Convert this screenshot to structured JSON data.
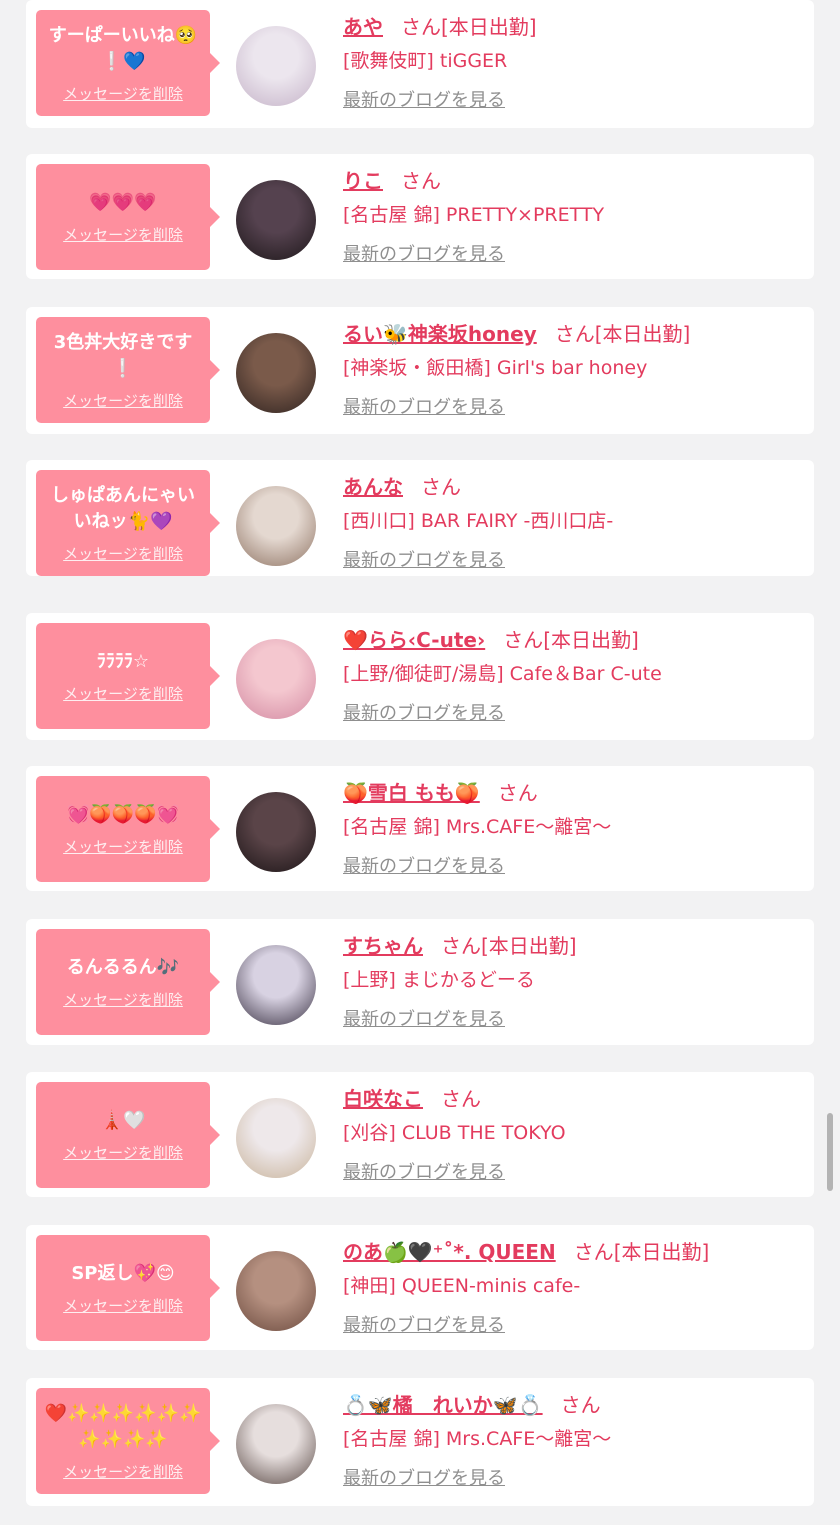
{
  "delete_label": "メッセージを削除",
  "blog_label": "最新のブログを見る",
  "honorific": "さん",
  "cards": [
    {
      "message": "すーぱーいいね🥺❕💙",
      "name": "あや",
      "attendance": "[本日出勤]",
      "shop": "[歌舞伎町] tiGGER",
      "avatar_colors": [
        "#ece6ee",
        "#c5b3c8"
      ]
    },
    {
      "message": "💗💗💗",
      "name": "りこ",
      "attendance": "",
      "shop": "[名古屋 錦] PRETTY×PRETTY",
      "avatar_colors": [
        "#55424f",
        "#1d1719"
      ]
    },
    {
      "message": "3色丼大好きです❕",
      "name": "るい🐝神楽坂honey",
      "attendance": "[本日出勤]",
      "shop": "[神楽坂・飯田橋] Girl's bar honey",
      "avatar_colors": [
        "#7a5a4a",
        "#2f2320"
      ]
    },
    {
      "message": "しゅぱあんにゃいいねッ🐈💜",
      "name": "あんな",
      "attendance": "",
      "shop": "[西川口] BAR FAIRY -西川口店-",
      "avatar_colors": [
        "#e4d8d0",
        "#8f7464"
      ]
    },
    {
      "message": "ﾗﾗﾗﾗ☆",
      "name": "❤️らら‹C-ute›",
      "attendance": "[本日出勤]",
      "shop": "[上野/御徒町/湯島] Cafe＆Bar C-ute",
      "avatar_colors": [
        "#f4c7cf",
        "#d38aa2"
      ]
    },
    {
      "message": "💓🍑🍑🍑💓",
      "name": "🍑雪白 もも🍑",
      "attendance": "",
      "shop": "[名古屋 錦] Mrs.CAFE〜離宮〜",
      "avatar_colors": [
        "#5a4448",
        "#1b1416"
      ]
    },
    {
      "message": "るんるるん🎶",
      "name": "すちゃん",
      "attendance": "[本日出勤]",
      "shop": "[上野] まじかるどーる",
      "avatar_colors": [
        "#d8d2e2",
        "#3b3344"
      ]
    },
    {
      "message": "🗼🤍",
      "name": "白咲なこ",
      "attendance": "",
      "shop": "[刈谷] CLUB THE TOKYO",
      "avatar_colors": [
        "#eee8ea",
        "#c8b39a"
      ]
    },
    {
      "message": "SP返し💖😊",
      "name": "のあ🍏🖤⁺˚*. QUEEN",
      "attendance": "[本日出勤]",
      "shop": "[神田] QUEEN-minis cafe-",
      "avatar_colors": [
        "#b59080",
        "#6b4a3e"
      ]
    },
    {
      "message": "❤️✨✨✨✨✨✨✨✨✨✨",
      "name": "💍🦋橘　れいか🦋💍",
      "attendance": "",
      "shop": "[名古屋 錦] Mrs.CAFE〜離宮〜",
      "avatar_colors": [
        "#e6dedd",
        "#5b4b47"
      ]
    }
  ]
}
